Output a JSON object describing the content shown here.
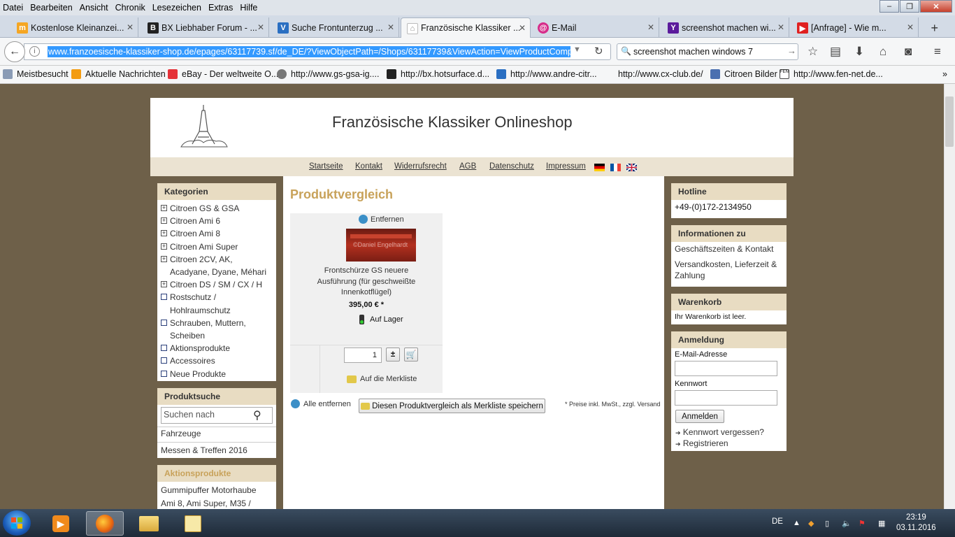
{
  "menu": [
    "Datei",
    "Bearbeiten",
    "Ansicht",
    "Chronik",
    "Lesezeichen",
    "Extras",
    "Hilfe"
  ],
  "tabs": [
    {
      "label": "Kostenlose Kleinanzei...",
      "icon": "m",
      "color": "#f5a623"
    },
    {
      "label": "BX Liebhaber Forum - ...",
      "icon": "B",
      "color": "#222"
    },
    {
      "label": "Suche Frontunterzug ...",
      "icon": "V",
      "color": "#2a6fc2"
    },
    {
      "label": "Französische Klassiker ...",
      "icon": "F",
      "color": "#888"
    },
    {
      "label": "E-Mail",
      "icon": "@",
      "color": "#d62d8a"
    },
    {
      "label": "screenshot machen wi...",
      "icon": "Y",
      "color": "#5b1b9c"
    },
    {
      "label": "[Anfrage] - Wie m...",
      "icon": "▶",
      "color": "#e02020"
    }
  ],
  "url": "www.franzoesische-klassiker-shop.de/epages/63117739.sf/de_DE/?ViewObjectPath=/Shops/63117739&ViewAction=ViewProductComparison&",
  "search_query": "screenshot machen windows 7",
  "bookmarks": [
    "Meistbesucht",
    "Aktuelle Nachrichten",
    "eBay - Der weltweite O...",
    "http://www.gs-gsa-ig....",
    "http://bx.hotsurface.d...",
    "http://www.andre-citr...",
    "http://www.cx-club.de/",
    "Citroen Bilder",
    "http://www.fen-net.de..."
  ],
  "shop": {
    "title": "Französische Klassiker Onlineshop",
    "nav": [
      "Startseite",
      "Kontakt",
      "Widerrufsrecht",
      "AGB",
      "Datenschutz",
      "Impressum"
    ],
    "categories_head": "Kategorien",
    "categories": [
      {
        "label": "Citroen GS & GSA",
        "type": "plus"
      },
      {
        "label": "Citroen Ami 6",
        "type": "plus"
      },
      {
        "label": "Citroen Ami 8",
        "type": "plus"
      },
      {
        "label": "Citroen Ami Super",
        "type": "plus"
      },
      {
        "label": "Citroen 2CV, AK,",
        "type": "plus"
      },
      {
        "label": "Acadyane, Dyane, Méhari",
        "type": "none"
      },
      {
        "label": "Citroen DS / SM / CX / H",
        "type": "plus"
      },
      {
        "label": "Rostschutz /",
        "type": "sq"
      },
      {
        "label": "Hohlraumschutz",
        "type": "none"
      },
      {
        "label": "Schrauben, Muttern,",
        "type": "sq"
      },
      {
        "label": "Scheiben",
        "type": "none"
      },
      {
        "label": "Aktionsprodukte",
        "type": "sq"
      },
      {
        "label": "Accessoires",
        "type": "sq"
      },
      {
        "label": "Neue Produkte",
        "type": "sq"
      }
    ],
    "search_head": "Produktsuche",
    "search_placeholder": "Suchen nach",
    "search_links": [
      "Fahrzeuge",
      "Messen & Treffen 2016"
    ],
    "promo_head": "Aktionsprodukte",
    "promo_item": [
      "Gummipuffer Motorhaube",
      "Ami 8, Ami Super, M35 /"
    ],
    "page_heading": "Produktvergleich",
    "remove_label": "Entfernen",
    "image_watermark": "©Daniel Engelhardt",
    "product_name": [
      "Frontschürze GS neuere",
      "Ausführung (für geschweißte",
      "Innenkotflügel)"
    ],
    "price": "395,00 € *",
    "stock": "Auf Lager",
    "qty": "1",
    "plusminus": "±",
    "wishlist": "Auf die Merkliste",
    "remove_all": "Alle entfernen",
    "save_button": "Diesen Produktvergleich als Merkliste speichern",
    "footnote": "* Preise inkl. MwSt., zzgl. Versand",
    "hotline_head": "Hotline",
    "hotline": "+49-(0)172-2134950",
    "info_head": "Informationen zu",
    "info_links": [
      "Geschäftszeiten & Kontakt",
      "Versandkosten, Lieferzeit &",
      "Zahlung"
    ],
    "cart_head": "Warenkorb",
    "cart_text": "Ihr Warenkorb ist leer.",
    "login_head": "Anmeldung",
    "email_label": "E-Mail-Adresse",
    "password_label": "Kennwort",
    "login_button": "Anmelden",
    "forgot": "Kennwort vergessen?",
    "register": "Registrieren",
    "accent": "#c8a25a"
  },
  "taskbar": {
    "lang": "DE",
    "time": "23:19",
    "date": "03.11.2016"
  }
}
